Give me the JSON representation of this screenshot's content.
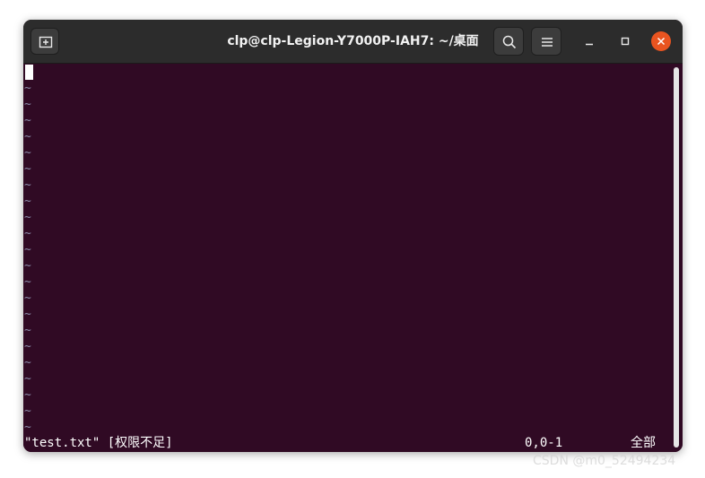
{
  "window": {
    "title": "clp@clp-Legion-Y7000P-IAH7: ~/桌面"
  },
  "titlebar_buttons": {
    "new_tab": "new-tab-icon",
    "search": "search-icon",
    "menu": "hamburger-menu-icon",
    "minimize": "minimize-icon",
    "maximize": "maximize-icon",
    "close": "close-icon"
  },
  "editor": {
    "empty_line_marker": "~",
    "empty_line_count": 22,
    "status_file": "\"test.txt\" [权限不足]",
    "cursor_position": "0,0-1",
    "scroll_scope": "全部"
  },
  "watermark": "CSDN @m0_52494234",
  "colors": {
    "terminal_bg": "#300a24",
    "titlebar_bg": "#2c2c2c",
    "close_button": "#e95420"
  }
}
